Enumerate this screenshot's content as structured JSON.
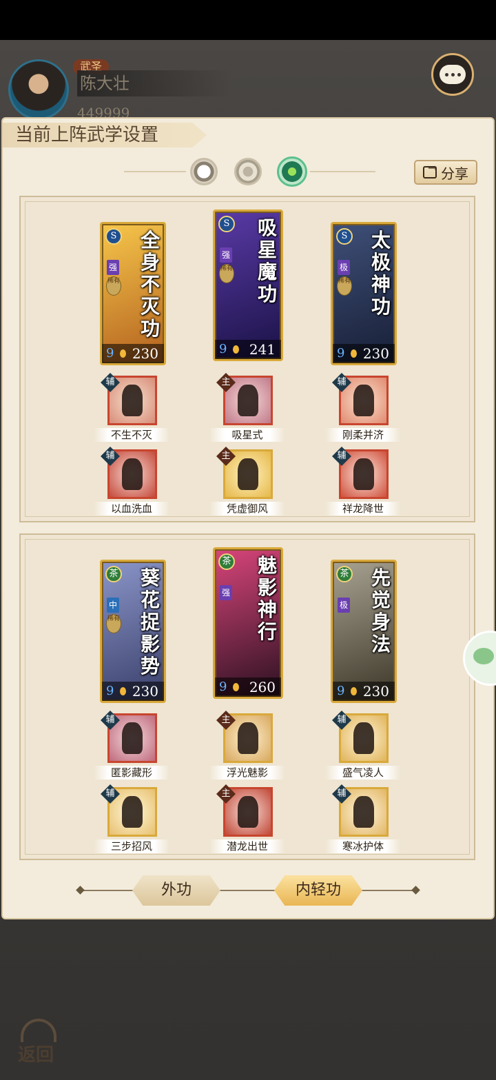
{
  "player": {
    "rank": "武圣",
    "name": "陈大壮",
    "coins": "449999"
  },
  "panel": {
    "title": "当前上阵武学设置",
    "share_label": "分享"
  },
  "modes": [
    "moon-icon",
    "sun-gear-icon",
    "green-moon-icon"
  ],
  "groups": [
    {
      "cards": [
        {
          "name": "全身不灭功",
          "grade": "强",
          "rare": "稀有",
          "type": "S",
          "power": "230",
          "colors": [
            "#f6c64a",
            "#b3611f"
          ]
        },
        {
          "name": "吸星魔功",
          "grade": "强",
          "rare": "稀有",
          "type": "S",
          "power": "241",
          "colors": [
            "#5a3aa6",
            "#1a1246"
          ]
        },
        {
          "name": "太极神功",
          "grade": "极",
          "rare": "稀有",
          "type": "S",
          "power": "230",
          "colors": [
            "#3f4f78",
            "#171f36"
          ]
        }
      ],
      "skills_row1": [
        {
          "badge": "辅",
          "label": "不生不灭"
        },
        {
          "badge": "主",
          "label": "吸星式"
        },
        {
          "badge": "辅",
          "label": "刚柔并济"
        }
      ],
      "skills_row2": [
        {
          "badge": "辅",
          "label": "以血洗血"
        },
        {
          "badge": "主",
          "label": "凭虚御风"
        },
        {
          "badge": "辅",
          "label": "祥龙降世"
        }
      ]
    },
    {
      "cards": [
        {
          "name": "葵花捉影势",
          "grade": "中",
          "rare": "稀有",
          "type": "茶",
          "power": "230",
          "colors": [
            "#8a95c8",
            "#3a3f6a"
          ]
        },
        {
          "name": "魅影神行",
          "grade": "强",
          "rare": "",
          "type": "茶",
          "power": "260",
          "colors": [
            "#d8457a",
            "#2a1120"
          ]
        },
        {
          "name": "先觉身法",
          "grade": "极",
          "rare": "",
          "type": "茶",
          "power": "230",
          "colors": [
            "#a8a292",
            "#3c3628"
          ]
        }
      ],
      "skills_row1": [
        {
          "badge": "辅",
          "label": "匿影藏形"
        },
        {
          "badge": "主",
          "label": "浮光魅影"
        },
        {
          "badge": "辅",
          "label": "盛气凌人"
        }
      ],
      "skills_row2": [
        {
          "badge": "辅",
          "label": "三步招风"
        },
        {
          "badge": "主",
          "label": "潜龙出世"
        },
        {
          "badge": "辅",
          "label": "寒冰护体"
        }
      ]
    }
  ],
  "tabs": {
    "outer": "外功",
    "inner": "内轻功",
    "active": "inner"
  },
  "back_label": "返回"
}
